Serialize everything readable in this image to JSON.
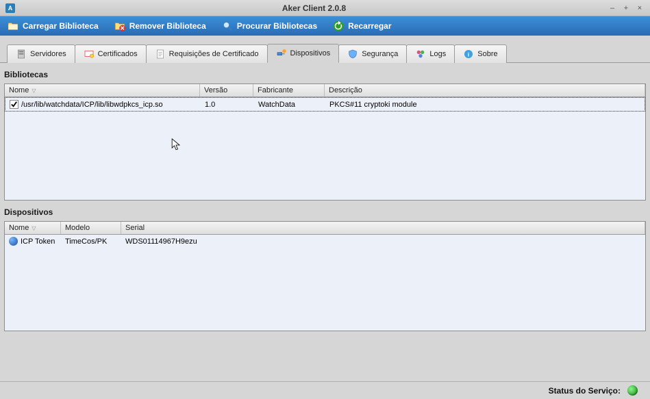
{
  "window": {
    "title": "Aker Client 2.0.8"
  },
  "toolbar": {
    "load_lib": "Carregar Biblioteca",
    "remove_lib": "Remover Biblioteca",
    "find_libs": "Procurar Bibliotecas",
    "reload": "Recarregar"
  },
  "tabs": {
    "servers": "Servidores",
    "certs": "Certificados",
    "certreq": "Requisições de Certificado",
    "devices": "Dispositivos",
    "security": "Segurança",
    "logs": "Logs",
    "about": "Sobre"
  },
  "libs": {
    "section": "Bibliotecas",
    "headers": {
      "name": "Nome",
      "version": "Versão",
      "maker": "Fabricante",
      "desc": "Descrição"
    },
    "row1": {
      "path": "/usr/lib/watchdata/ICP/lib/libwdpkcs_icp.so",
      "version": "1.0",
      "maker": "WatchData",
      "desc": "PKCS#11 cryptoki module"
    }
  },
  "devs": {
    "section": "Dispositivos",
    "headers": {
      "name": "Nome",
      "model": "Modelo",
      "serial": "Serial"
    },
    "row1": {
      "name": "ICP Token",
      "model": "TimeCos/PK",
      "serial": "WDS01114967H9ezu"
    }
  },
  "status": {
    "label": "Status do Serviço:"
  }
}
